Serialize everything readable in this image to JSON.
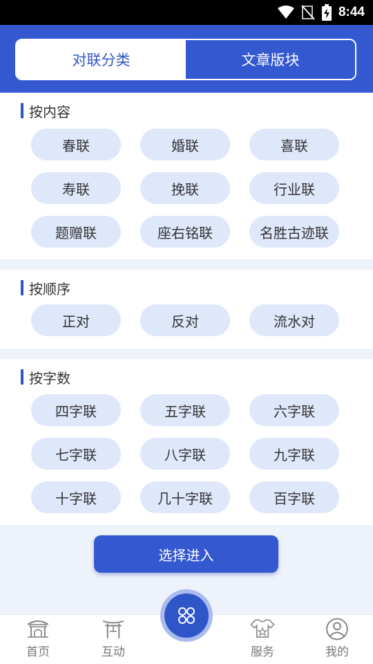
{
  "status_bar": {
    "time": "8:44"
  },
  "segmented": {
    "tabs": [
      {
        "label": "对联分类"
      },
      {
        "label": "文章版块"
      }
    ]
  },
  "sections": [
    {
      "title": "按内容",
      "items": [
        "春联",
        "婚联",
        "喜联",
        "寿联",
        "挽联",
        "行业联",
        "题赠联",
        "座右铭联",
        "名胜古迹联"
      ]
    },
    {
      "title": "按顺序",
      "items": [
        "正对",
        "反对",
        "流水对"
      ]
    },
    {
      "title": "按字数",
      "items": [
        "四字联",
        "五字联",
        "六字联",
        "七字联",
        "八字联",
        "九字联",
        "十字联",
        "几十字联",
        "百字联"
      ]
    }
  ],
  "actions": {
    "enter_label": "选择进入"
  },
  "tabbar": {
    "items": [
      {
        "label": "首页"
      },
      {
        "label": "互动"
      },
      {
        "label": "服务"
      },
      {
        "label": "我的"
      }
    ]
  },
  "colors": {
    "primary": "#3458cf",
    "chip_bg": "#dfe7fb",
    "page_bg": "#eef3fb"
  }
}
